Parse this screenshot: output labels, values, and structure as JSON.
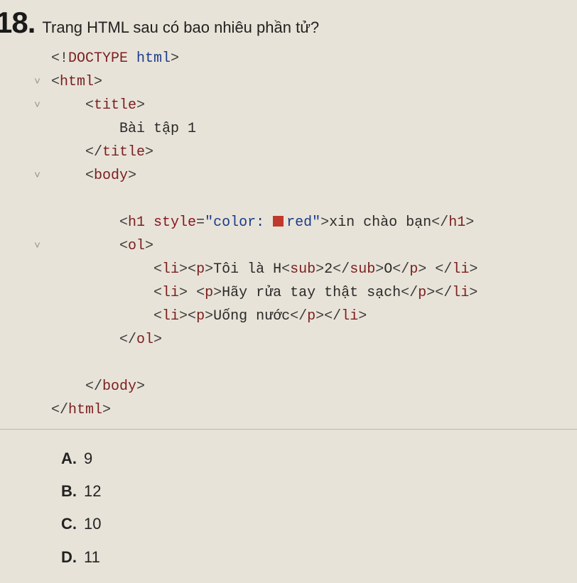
{
  "question": {
    "number": "18.",
    "text": "Trang HTML sau có bao nhiêu phần tử?"
  },
  "code": {
    "doctype_open": "<!",
    "doctype_kw": "DOCTYPE",
    "doctype_val": " html",
    "doctype_close": ">",
    "lt": "<",
    "lts": "</",
    "gt": ">",
    "html": "html",
    "title": "title",
    "body": "body",
    "h1": "h1",
    "ol": "ol",
    "li": "li",
    "p": "p",
    "sub": "sub",
    "style_attr": " style",
    "eq": "=",
    "quote": "\"",
    "style_val_pre": "color: ",
    "style_val_post": "red",
    "txt_title": "Bài tập 1",
    "txt_h1": "xin chào bạn",
    "txt_li1_a": "Tôi là H",
    "txt_li1_b": "2",
    "txt_li1_c": "O",
    "txt_li2": "Hãy rửa tay thật sạch",
    "txt_li3": "Uống nước",
    "space": " "
  },
  "chevron": "˅",
  "options": {
    "a": {
      "label": "A.",
      "value": "9"
    },
    "b": {
      "label": "B.",
      "value": "12"
    },
    "c": {
      "label": "C.",
      "value": "10"
    },
    "d": {
      "label": "D.",
      "value": "11"
    }
  }
}
